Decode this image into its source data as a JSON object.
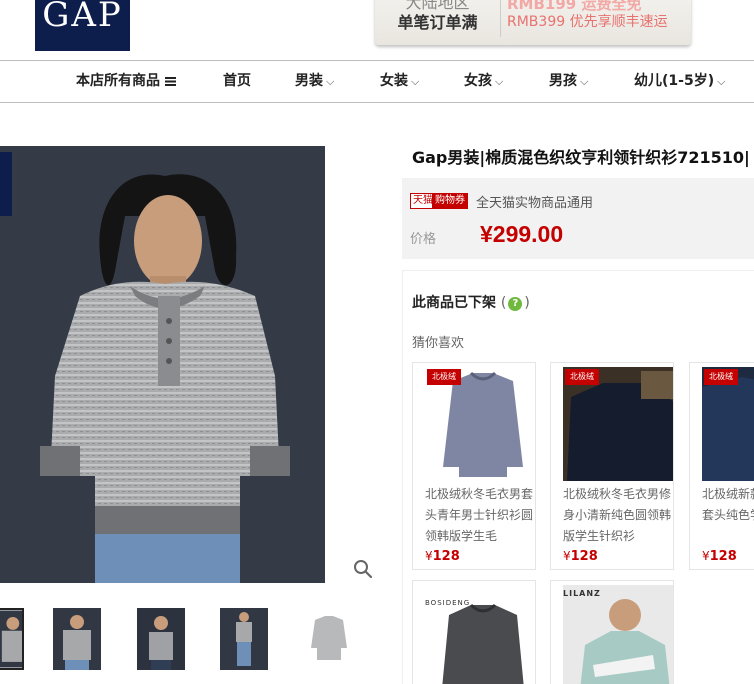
{
  "header": {
    "logo_text": "GAP",
    "promo_left_line1": "大陆地区",
    "promo_left_line2": "单笔订单满",
    "promo_right_line1": "RMB199 运费全免",
    "promo_right_line2": "RMB399 优先享顺丰速运"
  },
  "nav": {
    "items": [
      {
        "label": "本店所有商品",
        "icon": "list-icon"
      },
      {
        "label": "首页"
      },
      {
        "label": "男装",
        "caret": "⌵"
      },
      {
        "label": "女装",
        "caret": "⌵"
      },
      {
        "label": "女孩",
        "caret": "⌵"
      },
      {
        "label": "男孩",
        "caret": "⌵"
      },
      {
        "label": "幼儿(1-5岁)",
        "caret": "⌵"
      }
    ]
  },
  "product": {
    "title": "Gap男装|棉质混色织纹亨利领针织衫721510|",
    "tag_tmall": "天猫",
    "tag_coupon": "购物券",
    "coupon_text": "全天猫实物商品通用",
    "price_label": "价格",
    "price": "¥299.00",
    "offline_text": "此商品已下架",
    "paren_open": "(",
    "help_icon": "?",
    "paren_close": ")",
    "guess_label": "猜你喜欢"
  },
  "recommendations": [
    {
      "name": "北极绒秋冬毛衣男套头青年男士针织衫圆领韩版学生毛",
      "price_symbol": "¥",
      "price": "128",
      "badge": "北极绒"
    },
    {
      "name": "北极绒秋冬毛衣男修身小清新纯色圆领韩版学生针织衫",
      "price_symbol": "¥",
      "price": "128",
      "badge": "北极绒"
    },
    {
      "name": "北极绒新款男士圆领套头纯色学生",
      "price_symbol": "¥",
      "price": "128",
      "badge": "北极绒"
    },
    {
      "name": "",
      "price_symbol": "",
      "price": "",
      "brand": "BOSIDENG"
    },
    {
      "name": "",
      "price_symbol": "",
      "price": "",
      "brand": "LILANZ"
    }
  ],
  "colors": {
    "brand_navy": "#0d1e4d",
    "price_red": "#c40000",
    "help_green": "#6fb93f"
  }
}
